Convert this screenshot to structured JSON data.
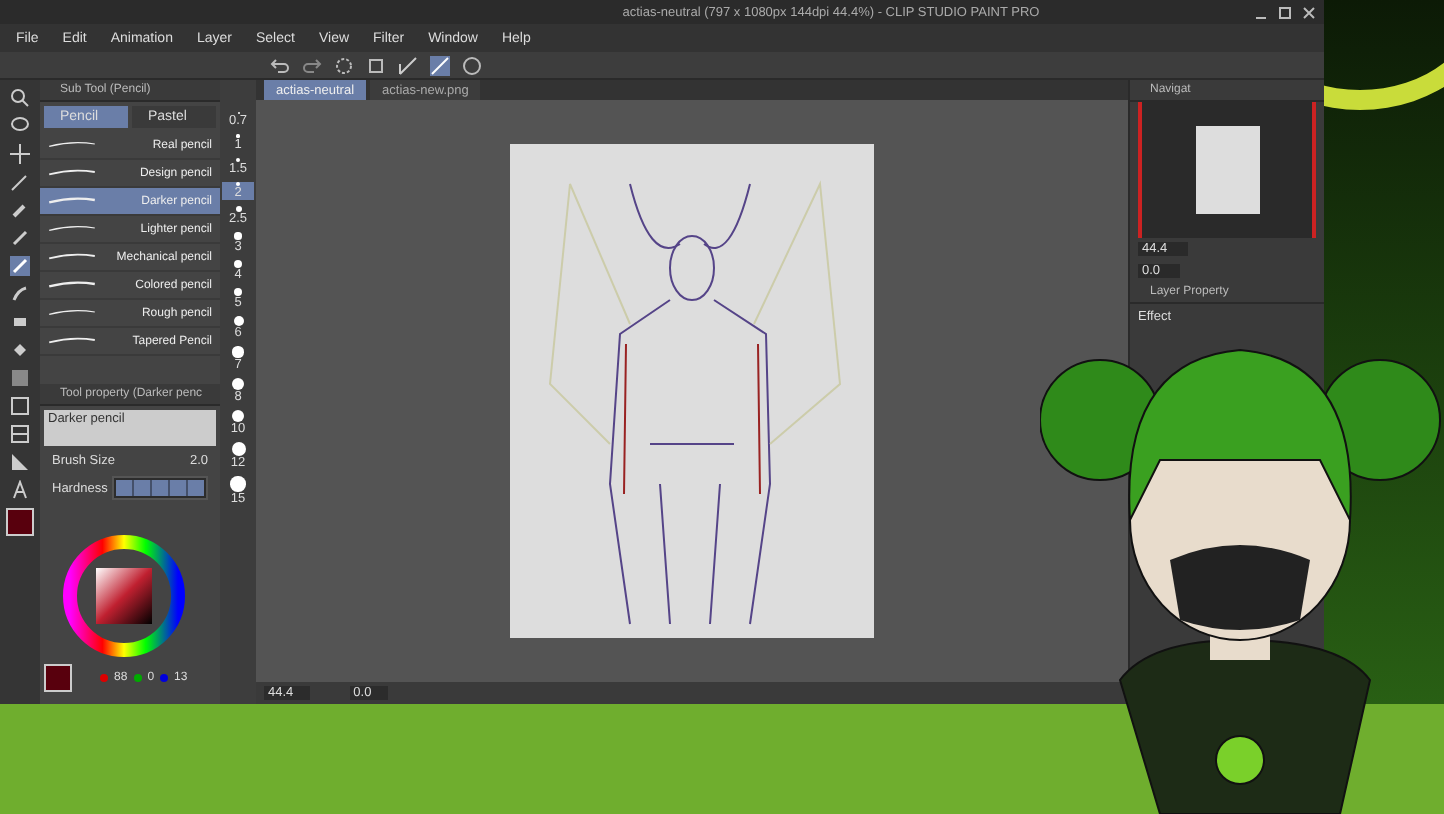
{
  "window": {
    "title": "actias-neutral (797 x 1080px 144dpi 44.4%) - CLIP STUDIO PAINT PRO"
  },
  "menu": [
    "File",
    "Edit",
    "Animation",
    "Layer",
    "Select",
    "View",
    "Filter",
    "Window",
    "Help"
  ],
  "sub_tool": {
    "title": "Sub Tool (Pencil)",
    "tabs": [
      {
        "label": "Pencil",
        "selected": true
      },
      {
        "label": "Pastel",
        "selected": false
      }
    ],
    "items": [
      {
        "label": "Real pencil",
        "selected": false
      },
      {
        "label": "Design pencil",
        "selected": false
      },
      {
        "label": "Darker pencil",
        "selected": true
      },
      {
        "label": "Lighter pencil",
        "selected": false
      },
      {
        "label": "Mechanical pencil",
        "selected": false
      },
      {
        "label": "Colored pencil",
        "selected": false
      },
      {
        "label": "Rough pencil",
        "selected": false
      },
      {
        "label": "Tapered Pencil",
        "selected": false
      }
    ]
  },
  "brush_sizes": [
    {
      "label": "0.7",
      "selected": false
    },
    {
      "label": "1",
      "selected": false
    },
    {
      "label": "1.5",
      "selected": false
    },
    {
      "label": "2",
      "selected": true
    },
    {
      "label": "2.5",
      "selected": false
    },
    {
      "label": "3",
      "selected": false
    },
    {
      "label": "4",
      "selected": false
    },
    {
      "label": "5",
      "selected": false
    },
    {
      "label": "6",
      "selected": false
    },
    {
      "label": "7",
      "selected": false
    },
    {
      "label": "8",
      "selected": false
    },
    {
      "label": "10",
      "selected": false
    },
    {
      "label": "12",
      "selected": false
    },
    {
      "label": "15",
      "selected": false
    }
  ],
  "tool_property": {
    "title": "Tool property (Darker penc",
    "preview": "Darker pencil",
    "brush_size_label": "Brush Size",
    "brush_size": "2.0",
    "hardness": {
      "label": "Hardness",
      "level": 1
    }
  },
  "color": {
    "r": "88",
    "g": "0",
    "b": "13"
  },
  "document_tabs": [
    {
      "label": "actias-neutral",
      "selected": true
    },
    {
      "label": "actias-new.png",
      "selected": false
    }
  ],
  "status": {
    "zoom": "44.4",
    "angle": "0.0"
  },
  "navigator": {
    "title": "Navigat",
    "zoom": "44.4",
    "angle": "0.0"
  },
  "layer_property": {
    "title": "Layer Property",
    "effect": "Effect"
  }
}
